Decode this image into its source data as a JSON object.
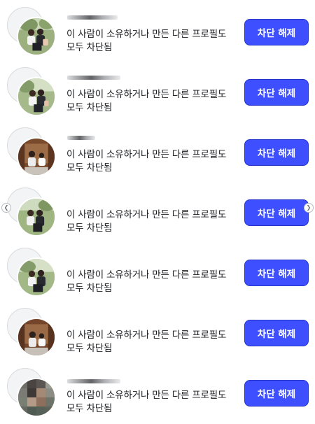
{
  "colors": {
    "button_bg": "#3e4fff",
    "button_text": "#ffffff",
    "text": "#1c1e21"
  },
  "blocked_list": [
    {
      "avatar": "outdoor-family-photo",
      "description_line1": "이 사람이 소유하거나 만든 다른 프로필도",
      "description_line2": "모두 차단됨",
      "button_label": "차단 해제"
    },
    {
      "avatar": "outdoor-family-photo",
      "description_line1": "이 사람이 소유하거나 만든 다른 프로필도",
      "description_line2": "모두 차단됨",
      "button_label": "차단 해제"
    },
    {
      "avatar": "indoor-family-photo",
      "description_line1": "이 사람이 소유하거나 만든 다른 프로필도",
      "description_line2": "모두 차단됨",
      "button_label": "차단 해제"
    },
    {
      "avatar": "outdoor-family-photo",
      "description_line1": "이 사람이 소유하거나 만든 다른 프로필도",
      "description_line2": "모두 차단됨",
      "button_label": "차단 해제"
    },
    {
      "avatar": "outdoor-family-photo",
      "description_line1": "이 사람이 소유하거나 만든 다른 프로필도",
      "description_line2": "모두 차단됨",
      "button_label": "차단 해제"
    },
    {
      "avatar": "indoor-family-photo",
      "description_line1": "이 사람이 소유하거나 만든 다른 프로필도",
      "description_line2": "모두 차단됨",
      "button_label": "차단 해제"
    },
    {
      "avatar": "pixelated-portrait",
      "description_line1": "이 사람이 소유하거나 만든 다른 프로필도",
      "description_line2": "모두 차단됨",
      "button_label": "차단 해제"
    }
  ]
}
